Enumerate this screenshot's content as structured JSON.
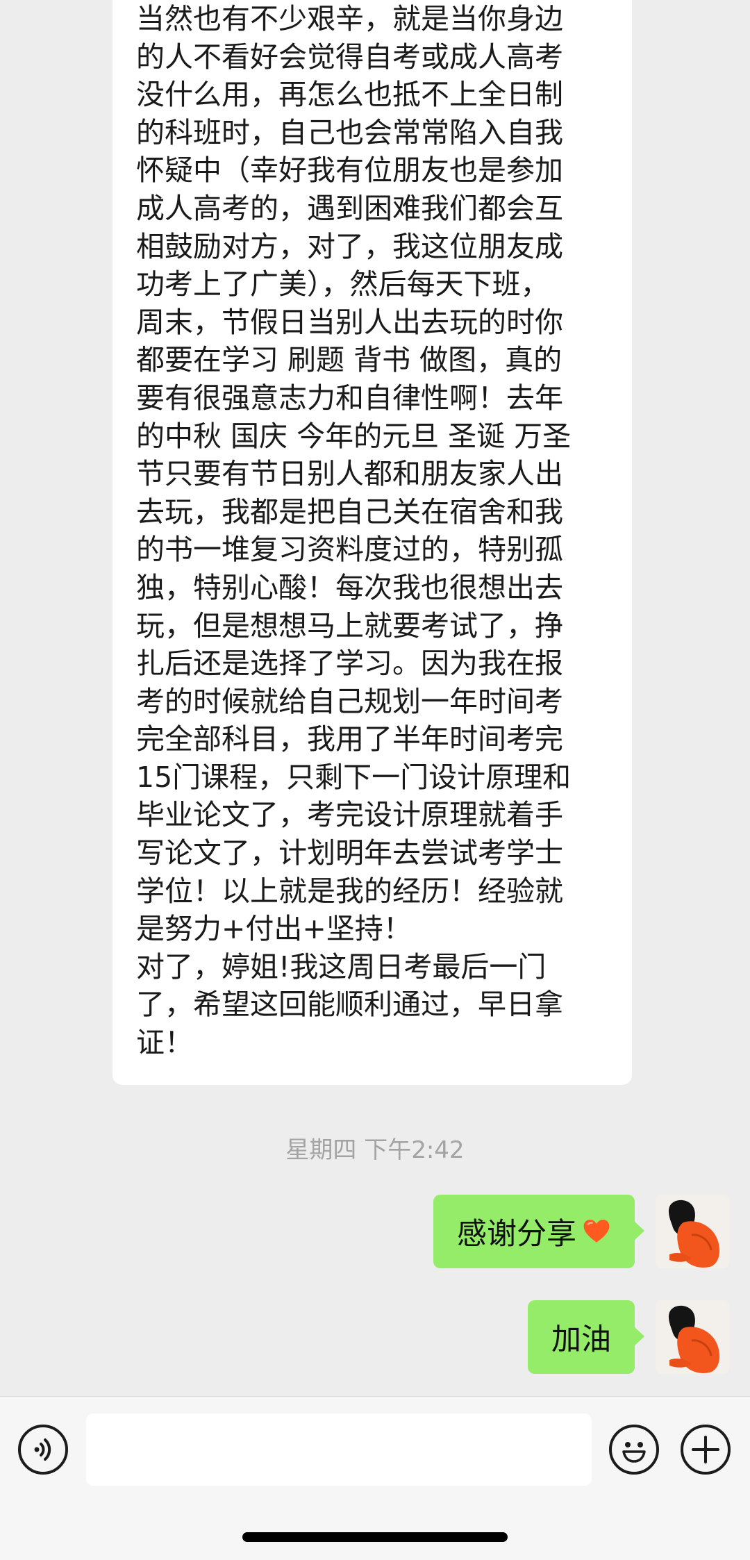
{
  "incoming_message": {
    "lines": [
      "当然也有不少艰辛，就是当你身边",
      "的人不看好会觉得自考或成人高考",
      "没什么用，再怎么也抵不上全日制",
      "的科班时，自己也会常常陷入自我",
      "怀疑中（幸好我有位朋友也是参加",
      "成人高考的，遇到困难我们都会互",
      "相鼓励对方，对了，我这位朋友成",
      "功考上了广美），然后每天下班，",
      "周末，节假日当别人出去玩的时你",
      "都要在学习 刷题 背书 做图，真的",
      "要有很强意志力和自律性啊！去年",
      "的中秋 国庆 今年的元旦 圣诞 万圣",
      "节只要有节日别人都和朋友家人出",
      "去玩，我都是把自己关在宿舍和我",
      "的书一堆复习资料度过的，特别孤",
      "独，特别心酸！每次我也很想出去",
      "玩，但是想想马上就要考试了，挣",
      "扎后还是选择了学习。因为我在报",
      "考的时候就给自己规划一年时间考",
      "完全部科目，我用了半年时间考完",
      "15门课程，只剩下一门设计原理和",
      "毕业论文了，考完设计原理就着手",
      "写论文了，计划明年去尝试考学士",
      "学位！以上就是我的经历！经验就",
      "是努力+付出+坚持！",
      "对了，婷姐!我这周日考最后一门",
      "了，希望这回能顺利通过，早日拿",
      "证！"
    ]
  },
  "timestamp": "星期四 下午2:42",
  "outgoing_messages": [
    {
      "text": "感谢分享",
      "emoji": "heart-icon"
    },
    {
      "text": "加油"
    }
  ],
  "colors": {
    "background": "#ededed",
    "incoming_bubble": "#ffffff",
    "outgoing_bubble": "#95ec69",
    "timestamp_text": "#a3a3a3"
  },
  "input_bar": {
    "voice_icon": "voice-icon",
    "emoji_icon": "emoji-icon",
    "plus_icon": "plus-icon",
    "text_value": ""
  }
}
